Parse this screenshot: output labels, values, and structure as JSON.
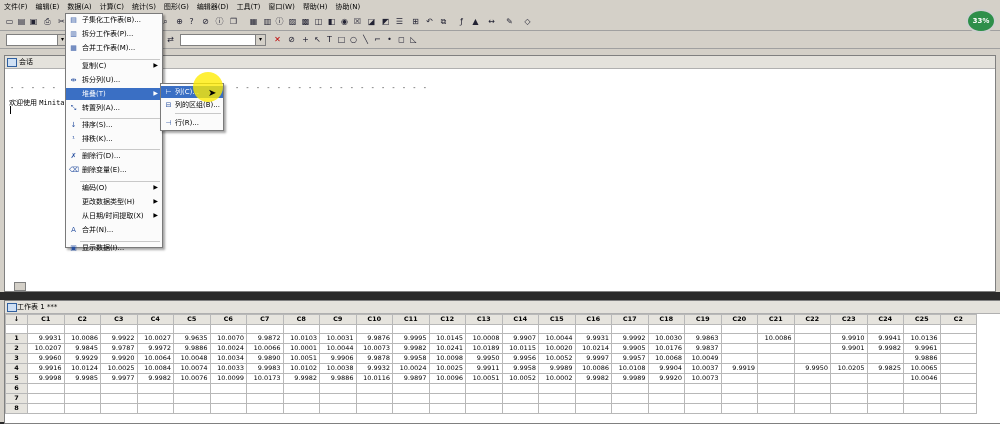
{
  "menubar": [
    "文件(F)",
    "编辑(E)",
    "数据(A)",
    "计算(C)",
    "统计(S)",
    "图形(G)",
    "编辑器(D)",
    "工具(T)",
    "窗口(W)",
    "帮助(H)",
    "协助(N)"
  ],
  "progress": "33%",
  "session": {
    "title": "会话",
    "dashes_left": "- - - - -",
    "dashes_right": "- - - - - - - - - - - - - - - - - - -",
    "welcome_text": "欢迎使用",
    "welcome_app": "Minitab"
  },
  "data_menu": {
    "items": [
      {
        "label": "子集化工作表(B)...",
        "icon": "subset-icon"
      },
      {
        "label": "拆分工作表(P)...",
        "icon": "split-sheet-icon"
      },
      {
        "label": "合并工作表(M)...",
        "icon": "merge-sheet-icon"
      },
      {
        "label": "复制(C)",
        "submenu": true
      },
      {
        "label": "拆分列(U)...",
        "icon": "split-column-icon"
      },
      {
        "label": "堆叠(T)",
        "submenu": true,
        "highlighted": true
      },
      {
        "label": "转置列(A)...",
        "icon": "transpose-icon"
      },
      {
        "label": "排序(S)...",
        "icon": "sort-icon"
      },
      {
        "label": "排秩(K)...",
        "icon": "rank-icon"
      },
      {
        "label": "删除行(D)...",
        "icon": "delete-rows-icon"
      },
      {
        "label": "删除变量(E)...",
        "icon": "erase-variables-icon"
      },
      {
        "label": "编码(O)",
        "submenu": true
      },
      {
        "label": "更改数据类型(H)",
        "submenu": true
      },
      {
        "label": "从日期/时间提取(X)",
        "submenu": true
      },
      {
        "label": "合并(N)...",
        "icon": "concatenate-icon"
      },
      {
        "label": "显示数据(I)...",
        "icon": "display-data-icon"
      }
    ]
  },
  "stack_submenu": {
    "items": [
      {
        "label": "列(C)...",
        "highlighted": true
      },
      {
        "label": "列的区组(B)..."
      },
      {
        "label": "行(R)..."
      }
    ]
  },
  "worksheet": {
    "title": "工作表 1 ***",
    "corner": "↓",
    "columns": [
      "C1",
      "C2",
      "C3",
      "C4",
      "C5",
      "C6",
      "C7",
      "C8",
      "C9",
      "C10",
      "C11",
      "C12",
      "C13",
      "C14",
      "C15",
      "C16",
      "C17",
      "C18",
      "C19",
      "C20",
      "C21",
      "C22",
      "C23",
      "C24",
      "C25",
      "C2"
    ],
    "rows": [
      {
        "n": "1",
        "vals": [
          "9.9931",
          "10.0086",
          "9.9922",
          "10.0027",
          "9.9635",
          "10.0070",
          "9.9872",
          "10.0103",
          "10.0031",
          "9.9876",
          "9.9995",
          "10.0145",
          "10.0008",
          "9.9907",
          "10.0044",
          "9.9931",
          "9.9992",
          "10.0030",
          "9.9863",
          "",
          "10.0086",
          "",
          "9.9910",
          "9.9941",
          "10.0136",
          ""
        ]
      },
      {
        "n": "2",
        "vals": [
          "10.0207",
          "9.9845",
          "9.9787",
          "9.9972",
          "9.9886",
          "10.0024",
          "10.0066",
          "10.0001",
          "10.0044",
          "10.0073",
          "9.9982",
          "10.0241",
          "10.0189",
          "10.0115",
          "10.0020",
          "10.0214",
          "9.9905",
          "10.0176",
          "9.9837",
          "",
          "",
          "",
          "9.9901",
          "9.9982",
          "9.9961",
          ""
        ]
      },
      {
        "n": "3",
        "vals": [
          "9.9960",
          "9.9929",
          "9.9920",
          "10.0064",
          "10.0048",
          "10.0034",
          "9.9890",
          "10.0051",
          "9.9906",
          "9.9878",
          "9.9958",
          "10.0098",
          "9.9950",
          "9.9956",
          "10.0052",
          "9.9997",
          "9.9957",
          "10.0068",
          "10.0049",
          "",
          "",
          "",
          "",
          "",
          "9.9886",
          ""
        ]
      },
      {
        "n": "4",
        "vals": [
          "9.9916",
          "10.0124",
          "10.0025",
          "10.0084",
          "10.0074",
          "10.0033",
          "9.9983",
          "10.0102",
          "10.0038",
          "9.9932",
          "10.0024",
          "10.0025",
          "9.9911",
          "9.9958",
          "9.9989",
          "10.0086",
          "10.0108",
          "9.9904",
          "10.0037",
          "9.9919",
          "",
          "9.9950",
          "10.0205",
          "9.9825",
          "10.0065",
          ""
        ]
      },
      {
        "n": "5",
        "vals": [
          "9.9998",
          "9.9985",
          "9.9977",
          "9.9982",
          "10.0076",
          "10.0099",
          "10.0173",
          "9.9982",
          "9.9886",
          "10.0116",
          "9.9897",
          "10.0096",
          "10.0051",
          "10.0052",
          "10.0002",
          "9.9982",
          "9.9989",
          "9.9920",
          "10.0073",
          "",
          "",
          "",
          "",
          "",
          "10.0046",
          ""
        ]
      },
      {
        "n": "6",
        "vals": [
          "",
          "",
          "",
          "",
          "",
          "",
          "",
          "",
          "",
          "",
          "",
          "",
          "",
          "",
          "",
          "",
          "",
          "",
          "",
          "",
          "",
          "",
          "",
          "",
          "",
          ""
        ]
      },
      {
        "n": "7",
        "vals": [
          "",
          "",
          "",
          "",
          "",
          "",
          "",
          "",
          "",
          "",
          "",
          "",
          "",
          "",
          "",
          "",
          "",
          "",
          "",
          "",
          "",
          "",
          "",
          "",
          "",
          ""
        ]
      },
      {
        "n": "8",
        "vals": [
          "",
          "",
          "",
          "",
          "",
          "",
          "",
          "",
          "",
          "",
          "",
          "",
          "",
          "",
          "",
          "",
          "",
          "",
          "",
          "",
          "",
          "",
          "",
          "",
          "",
          ""
        ]
      }
    ]
  }
}
